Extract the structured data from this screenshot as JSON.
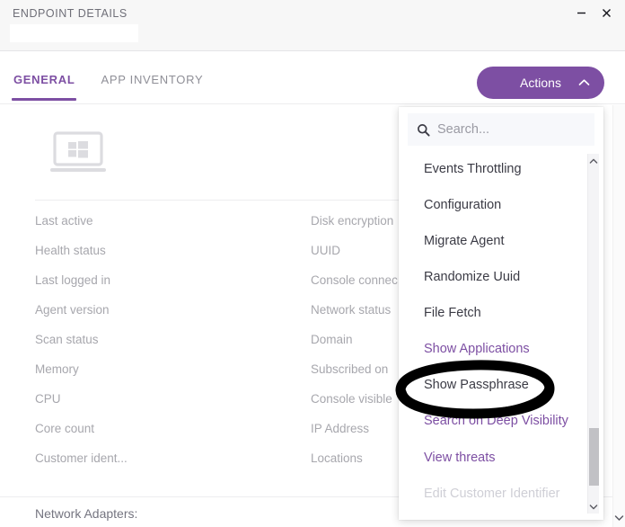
{
  "window": {
    "title": "ENDPOINT DETAILS",
    "minimize_label": "−",
    "close_label": "×"
  },
  "tabs": [
    {
      "label": "GENERAL",
      "active": true
    },
    {
      "label": "APP INVENTORY",
      "active": false
    }
  ],
  "actions": {
    "label": "Actions",
    "expanded": true,
    "accent_color": "#7d4fa3"
  },
  "details": {
    "left_column": [
      "Last active",
      "Health status",
      "Last logged in",
      "Agent version",
      "Scan status",
      "Memory",
      "CPU",
      "Core count",
      "Customer ident..."
    ],
    "middle_column": [
      "Disk encryption",
      "UUID",
      "Console connec",
      "Network status",
      "Domain",
      "Subscribed on",
      "Console visible",
      "IP Address",
      "Locations"
    ],
    "section_title": "Network Adapters:"
  },
  "dropdown": {
    "search_placeholder": "Search...",
    "search_value": "",
    "items": [
      {
        "label": "Events Throttling",
        "style": "normal"
      },
      {
        "label": "Configuration",
        "style": "normal"
      },
      {
        "label": "Migrate Agent",
        "style": "normal"
      },
      {
        "label": "Randomize Uuid",
        "style": "normal"
      },
      {
        "label": "File Fetch",
        "style": "normal"
      },
      {
        "label": "Show Applications",
        "style": "link"
      },
      {
        "label": "Show Passphrase",
        "style": "normal"
      },
      {
        "label": "Search on Deep Visibility",
        "style": "link"
      },
      {
        "label": "View threats",
        "style": "link"
      },
      {
        "label": "Edit Customer Identifier",
        "style": "disabled"
      }
    ],
    "link_color": "#7d4fa3",
    "disabled_color": "#cfcfd6"
  },
  "annotation": {
    "target": "Show Passphrase",
    "shape": "ellipse",
    "color": "#000000"
  }
}
